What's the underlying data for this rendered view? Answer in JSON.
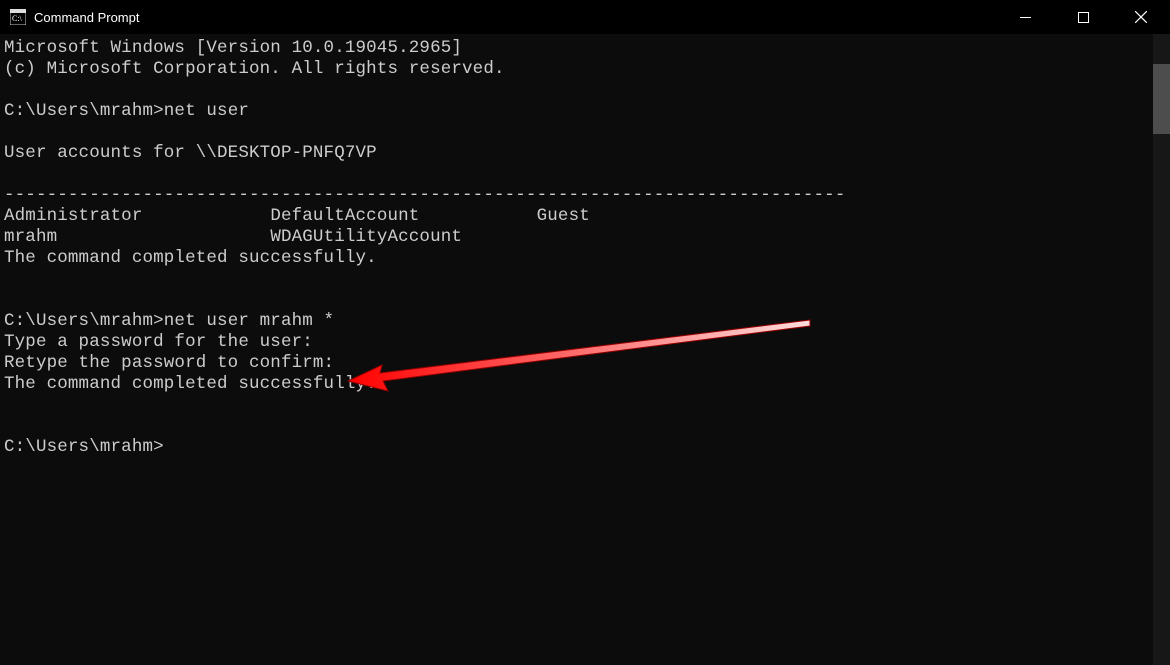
{
  "window": {
    "title": "Command Prompt"
  },
  "terminal": {
    "line_header1": "Microsoft Windows [Version 10.0.19045.2965]",
    "line_header2": "(c) Microsoft Corporation. All rights reserved.",
    "prompt1": "C:\\Users\\mrahm>",
    "cmd1": "net user",
    "accounts_header": "User accounts for \\\\DESKTOP-PNFQ7VP",
    "divider": "-------------------------------------------------------------------------------",
    "row1_col1": "Administrator",
    "row1_col2": "DefaultAccount",
    "row1_col3": "Guest",
    "row2_col1": "mrahm",
    "row2_col2": "WDAGUtilityAccount",
    "success1": "The command completed successfully.",
    "prompt2": "C:\\Users\\mrahm>",
    "cmd2": "net user mrahm *",
    "pw_line1": "Type a password for the user:",
    "pw_line2": "Retype the password to confirm:",
    "success2": "The command completed successfully.",
    "prompt3": "C:\\Users\\mrahm>"
  }
}
